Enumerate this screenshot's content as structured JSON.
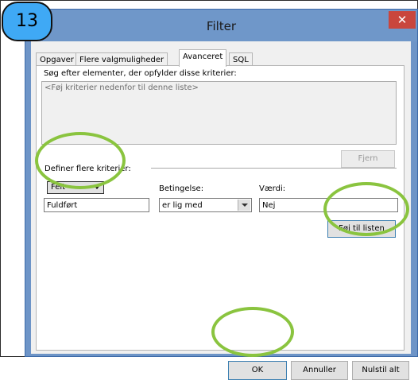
{
  "step_badge": "13",
  "window": {
    "title": "Filter",
    "close_glyph": "✕"
  },
  "tabs": [
    {
      "label": "Opgaver"
    },
    {
      "label": "Flere valgmuligheder"
    },
    {
      "label": "Avanceret"
    },
    {
      "label": "SQL"
    }
  ],
  "active_tab": "Avanceret",
  "advanced": {
    "search_label": "Søg efter elementer, der opfylder disse kriterier:",
    "criteria_placeholder": "<Føj kriterier nedenfor til denne liste>",
    "remove_button": "Fjern",
    "define_label": "Definer flere kriterier:",
    "field_button": "Felt",
    "field_value": "Fuldført",
    "condition_label": "Betingelse:",
    "condition_value": "er lig med",
    "value_label": "Værdi:",
    "value_value": "Nej",
    "add_button": "Føj til listen"
  },
  "footer": {
    "ok": "OK",
    "cancel": "Annuller",
    "reset": "Nulstil alt"
  },
  "colors": {
    "highlight_ring": "#8ac43f",
    "badge": "#3fa9f5",
    "titlebar": "#6f97c9"
  }
}
